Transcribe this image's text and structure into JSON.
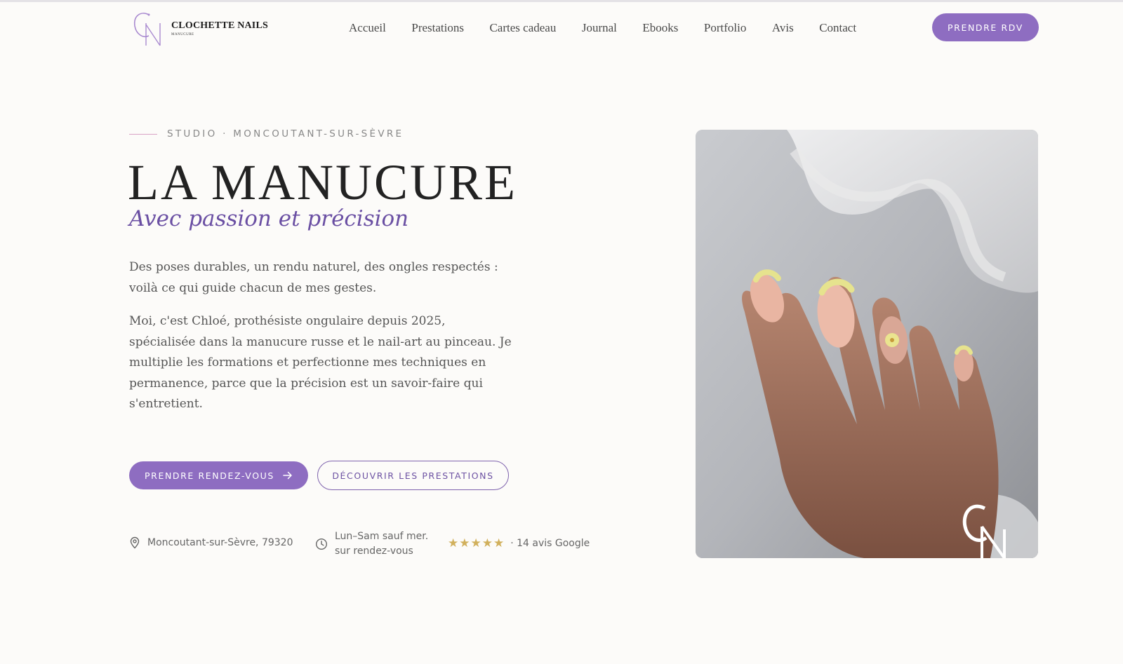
{
  "brand": {
    "name": "CLOCHETTE NAILS",
    "tagline": "MANUCURE",
    "accent_color": "#8e6dc1"
  },
  "nav": {
    "items": [
      "Accueil",
      "Prestations",
      "Cartes cadeau",
      "Journal",
      "Ebooks",
      "Portfolio",
      "Avis",
      "Contact"
    ],
    "cta_label": "PRENDRE RDV"
  },
  "hero": {
    "eyebrow": "STUDIO · MONCOUTANT-SUR-SÈVRE",
    "title": "LA MANUCURE",
    "subtitle": "Avec passion et précision",
    "paragraph_1": "Des poses durables, un rendu naturel, des ongles respectés : voilà ce qui guide chacun de mes gestes.",
    "paragraph_2": "Moi, c'est Chloé, prothésiste ongulaire depuis 2025, spécialisée dans la manucure russe et le nail-art au pinceau. Je multiplie les formations et perfectionne mes techniques en permanence, parce que la précision est un savoir-faire qui s'entretient.",
    "primary_button": "PRENDRE RENDEZ-VOUS",
    "secondary_button": "DÉCOUVRIR LES PRESTATIONS"
  },
  "info": {
    "location": "Moncoutant-sur-Sèvre, 79320",
    "hours_line_1": "Lun–Sam sauf mer.",
    "hours_line_2": "sur rendez-vous",
    "rating_stars": 5,
    "rating_text": "· 14 avis Google",
    "icons": [
      "location-pin-icon",
      "clock-icon",
      "star-icon"
    ]
  },
  "image": {
    "icon": "hand-manicure-photo"
  }
}
